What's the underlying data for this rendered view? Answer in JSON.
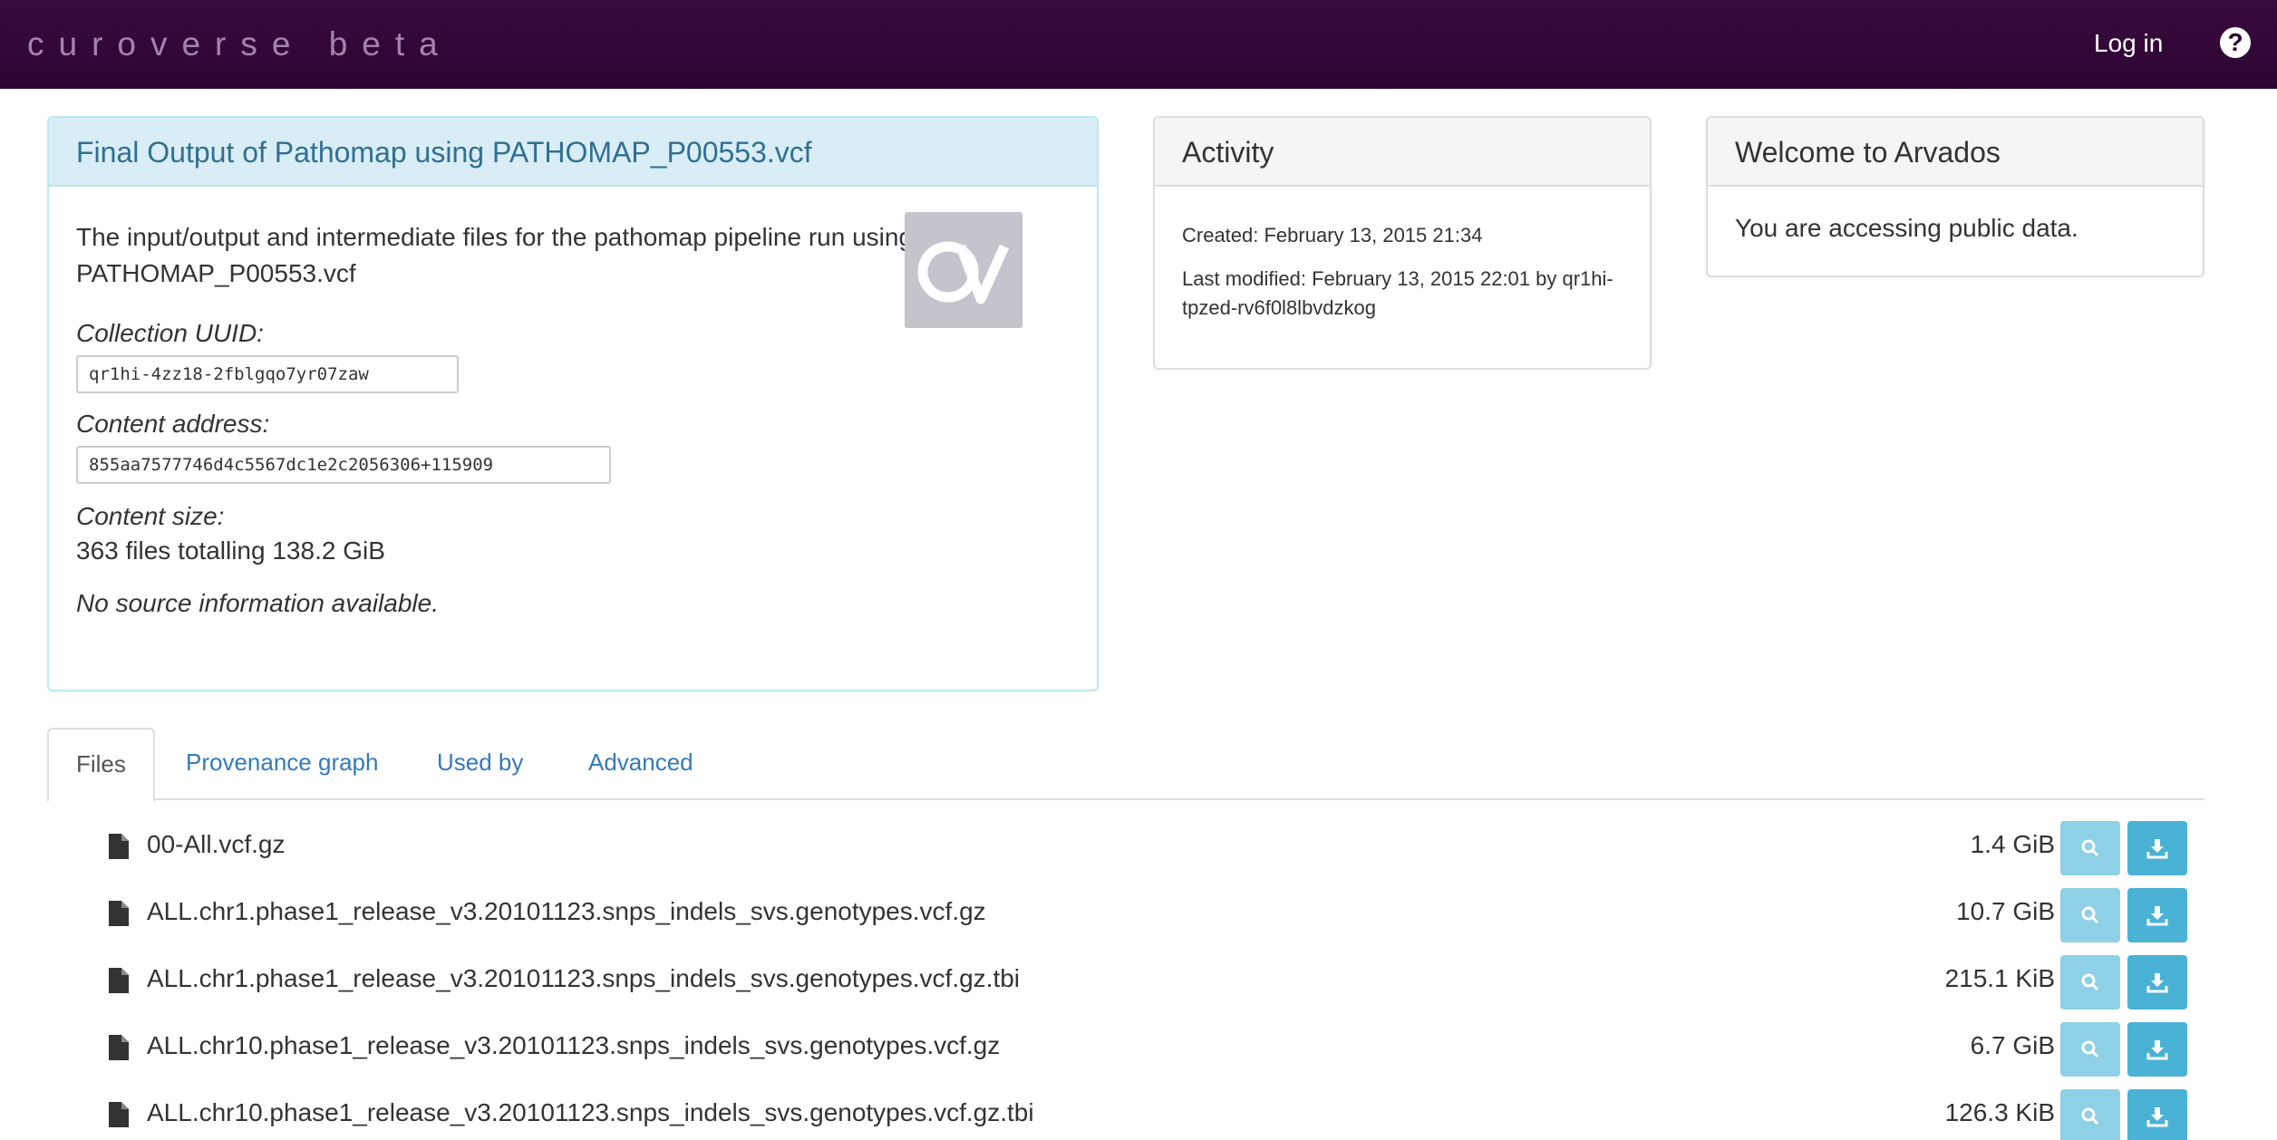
{
  "navbar": {
    "brand": "curoverse beta",
    "login": "Log in",
    "help_icon": "question-circle-icon"
  },
  "collection": {
    "title": "Final Output of Pathomap using PATHOMAP_P00553.vcf",
    "description_line1": "The input/output and intermediate files for the pathomap pipeline run using",
    "description_line2": "PATHOMAP_P00553.vcf",
    "uuid_label": "Collection UUID:",
    "uuid_value": "qr1hi-4zz18-2fblgqo7yr07zaw",
    "content_address_label": "Content address:",
    "content_address_value": "855aa7577746d4c5567dc1e2c2056306+115909",
    "content_size_label": "Content size:",
    "content_size_value": "363 files totalling 138.2 GiB",
    "source_info": "No source information available."
  },
  "activity": {
    "title": "Activity",
    "created": "Created: February 13, 2015 21:34",
    "modified_line1": "Last modified: February 13, 2015 22:01 by qr1hi-",
    "modified_line2": "tpzed-rv6f0l8lbvdzkog"
  },
  "welcome": {
    "title": "Welcome to Arvados",
    "message": "You are accessing public data."
  },
  "tabs": [
    {
      "label": "Files",
      "active": true
    },
    {
      "label": "Provenance graph",
      "active": false
    },
    {
      "label": "Used by",
      "active": false
    },
    {
      "label": "Advanced",
      "active": false
    }
  ],
  "files": [
    {
      "name": "00-All.vcf.gz",
      "size": "1.4 GiB"
    },
    {
      "name": "ALL.chr1.phase1_release_v3.20101123.snps_indels_svs.genotypes.vcf.gz",
      "size": "10.7 GiB"
    },
    {
      "name": "ALL.chr1.phase1_release_v3.20101123.snps_indels_svs.genotypes.vcf.gz.tbi",
      "size": "215.1 KiB"
    },
    {
      "name": "ALL.chr10.phase1_release_v3.20101123.snps_indels_svs.genotypes.vcf.gz",
      "size": "6.7 GiB"
    },
    {
      "name": "ALL.chr10.phase1_release_v3.20101123.snps_indels_svs.genotypes.vcf.gz.tbi",
      "size": "126.3 KiB"
    }
  ],
  "colors": {
    "navbar": "#2a0530",
    "link": "#337ab7",
    "view_button": "#8ed0e5",
    "download_button": "#49b2d5"
  }
}
